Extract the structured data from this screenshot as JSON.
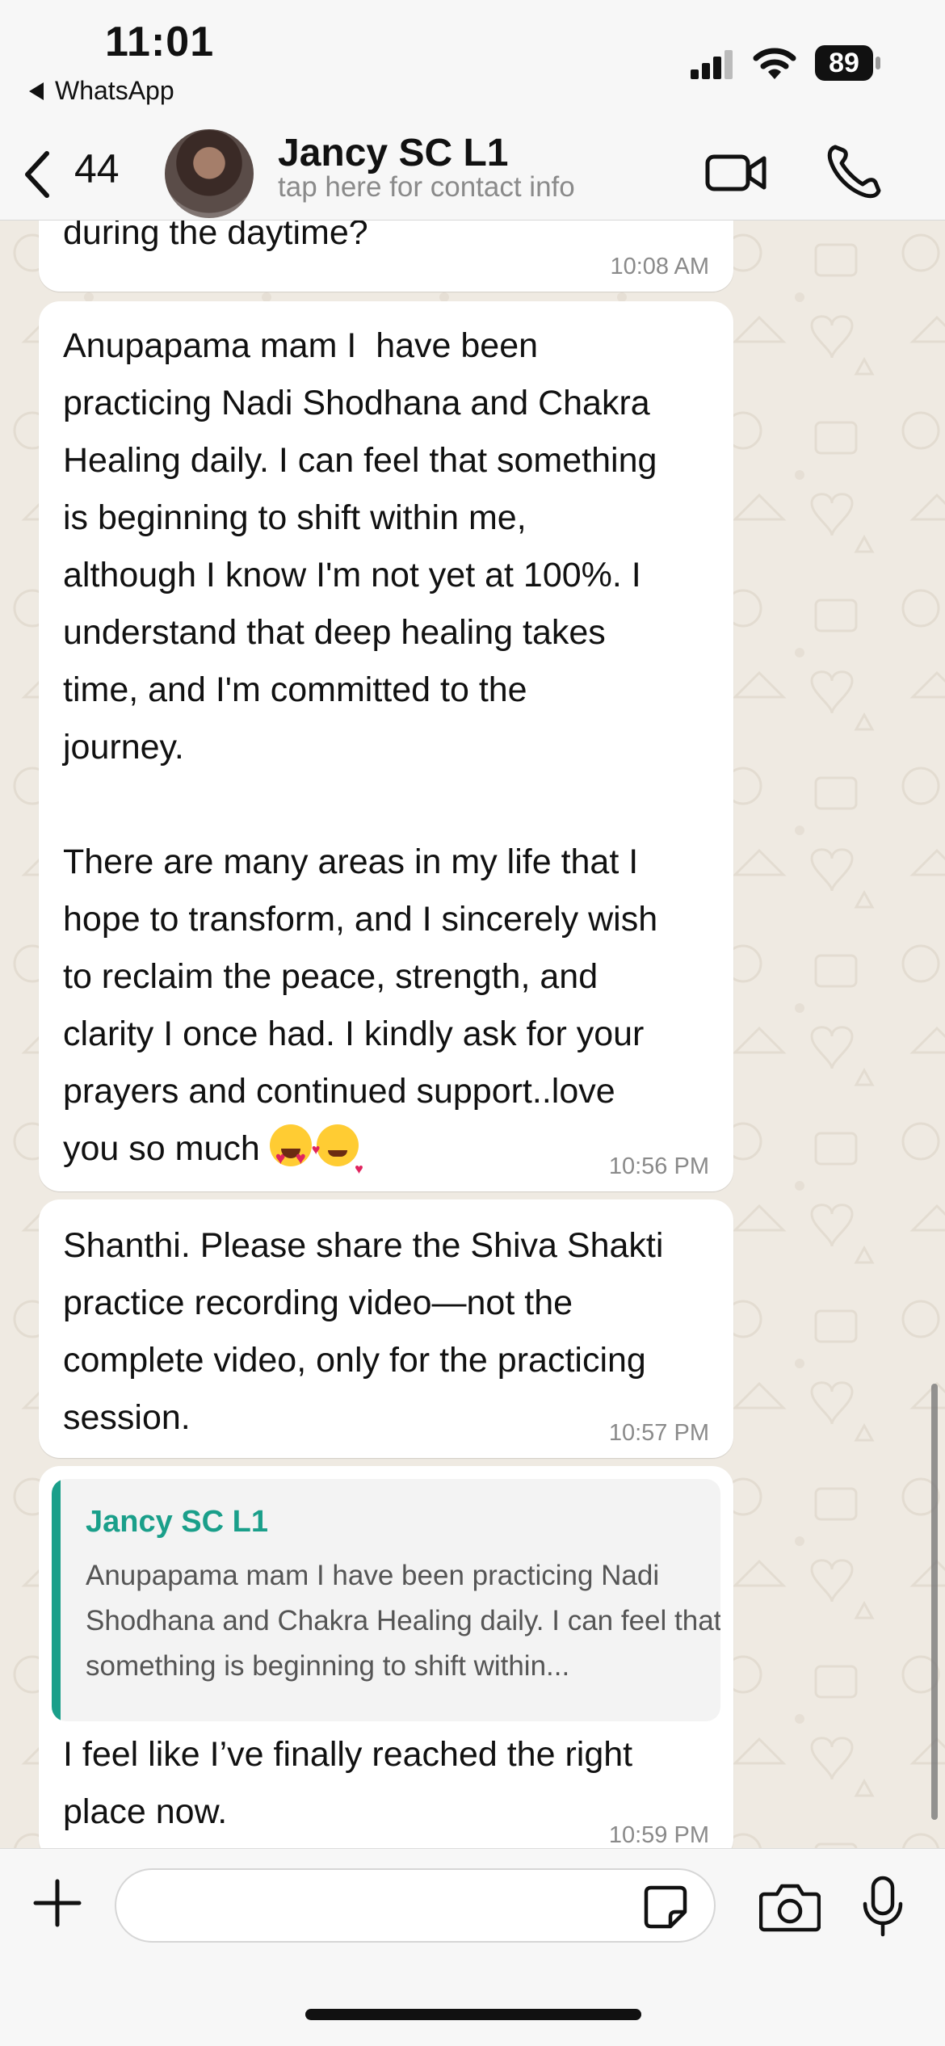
{
  "status_bar": {
    "time": "11:01",
    "back_app_label": "WhatsApp",
    "battery_level": "89",
    "signal_icon": "cellular-signal-icon",
    "wifi_icon": "wifi-icon"
  },
  "header": {
    "back_icon": "chevron-left-icon",
    "unread_count": "44",
    "contact_name": "Jancy SC L1",
    "contact_subtitle": "tap here for contact info",
    "video_icon": "video-camera-icon",
    "call_icon": "phone-icon"
  },
  "messages": [
    {
      "text": "during the daytime?",
      "time": "10:08 AM"
    },
    {
      "text": "Anupapama mam I  have been\npracticing Nadi Shodhana and Chakra\nHealing daily. I can feel that something\nis beginning to shift within me,\nalthough I know I'm not yet at 100%. I\nunderstand that deep healing takes\ntime, and I'm committed to the\njourney.\n\nThere are many areas in my life that I\nhope to transform, and I sincerely wish\nto reclaim the peace, strength, and\nclarity I once had. I kindly ask for your\nprayers and continued support..love\nyou so much",
      "emojis": [
        "😍",
        "🥰"
      ],
      "time": "10:56 PM"
    },
    {
      "text": "Shanthi. Please share the Shiva Shakti\npractice recording video—not the\ncomplete video, only for the practicing\nsession.",
      "time": "10:57 PM"
    },
    {
      "quote": {
        "author": "Jancy SC L1",
        "text": "Anupapama mam I  have been practicing Nadi Shodhana and Chakra Healing daily. I can feel that something is beginning to shift within..."
      },
      "text": "I feel like I’ve finally reached the right\nplace now.",
      "time": "10:59 PM"
    }
  ],
  "input_bar": {
    "placeholder": "",
    "plus_icon": "plus-icon",
    "sticker_icon": "sticker-icon",
    "camera_icon": "camera-icon",
    "mic_icon": "microphone-icon"
  },
  "colors": {
    "chat_background": "#efeae2",
    "bubble": "#ffffff",
    "quote_accent": "#1a9f8a",
    "bar_background": "#f7f7f7"
  }
}
